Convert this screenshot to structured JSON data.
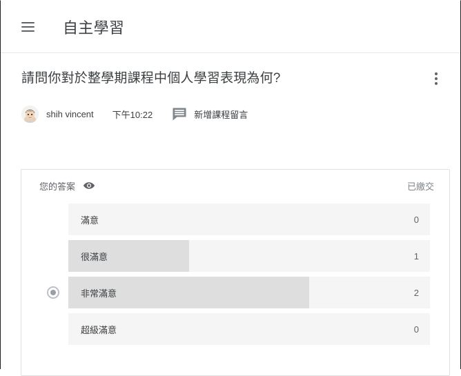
{
  "appbar": {
    "menu_icon": "hamburger-menu-icon",
    "title": "自主學習"
  },
  "question": {
    "title": "請問你對於整學期課程中個人學習表現為何?",
    "overflow_icon": "more-vert-icon",
    "author": "shih vincent",
    "time": "下午10:22",
    "comment_icon": "comment-icon",
    "comment_action": "新增課程留言"
  },
  "answer_card": {
    "your_answer_label": "您的答案",
    "visibility_icon": "eye-icon",
    "status": "已繳交"
  },
  "chart_data": {
    "type": "bar",
    "title": "請問你對於整學期課程中個人學習表現為何?",
    "xlabel": "",
    "ylabel": "",
    "orientation": "horizontal",
    "categories": [
      "滿意",
      "很滿意",
      "非常滿意",
      "超級滿意"
    ],
    "values": [
      0,
      1,
      2,
      0
    ],
    "value_labels": [
      "0",
      "1",
      "2",
      "0"
    ],
    "max_value": 3,
    "selected_category": "非常滿意",
    "selected_index": 2,
    "grid": false,
    "legend": false,
    "colors": {
      "track": "#f5f5f5",
      "fill": "#dededf",
      "text": "#3c4043",
      "count": "#5f6368",
      "radio": "#9aa0a6"
    }
  }
}
